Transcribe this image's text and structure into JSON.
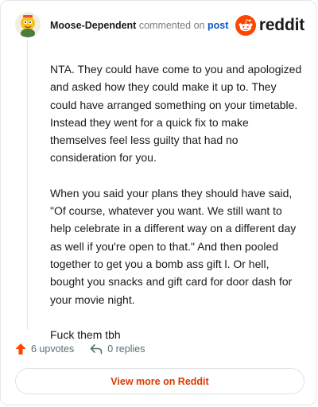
{
  "header": {
    "username": "Moose-Dependent",
    "action_text": "commented on",
    "post_link": "post",
    "brand_word": "reddit"
  },
  "comment": {
    "paragraphs": [
      "NTA. They could have come to you and apologized and asked how they could make it up to. They could have arranged something on your timetable. Instead they went for a quick fix to make themselves feel less guilty that had no consideration for you.",
      "When you said your plans they should have said, \"Of course, whatever you want. We still want to help celebrate in a different way on a different day as well if you're open to that.\" And then pooled together to get you a bomb ass gift l. Or hell, bought you snacks and gift card for door dash for your movie night.",
      "Fuck them tbh"
    ]
  },
  "actions": {
    "upvotes_label": "6 upvotes",
    "replies_label": "0 replies"
  },
  "footer": {
    "view_button_label": "View more on Reddit"
  },
  "icons": {
    "upvote": "upvote-arrow-icon",
    "reply": "reply-arrow-icon",
    "brand": "reddit-snoo-icon"
  },
  "colors": {
    "accent": "#ff4500",
    "link": "#0a58ca",
    "button_text": "#d93a00"
  }
}
